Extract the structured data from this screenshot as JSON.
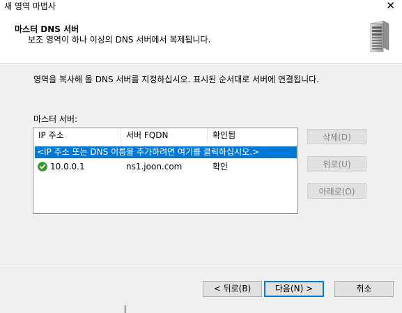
{
  "window": {
    "title": "새 영역 마법사",
    "close_glyph": "✕"
  },
  "header": {
    "title": "마스터 DNS 서버",
    "subtitle": "보조 영역이 하나 이상의 DNS 서버에서 복제됩니다."
  },
  "body": {
    "description": "영역을 복사해 올 DNS 서버를 지정하십시오. 표시된 순서대로 서버에 연결됩니다.",
    "list_label": "마스터 서버:",
    "columns": [
      "IP 주소",
      "서버 FQDN",
      "확인됨"
    ],
    "add_row": "<IP 주소 또는 DNS 이름을 추가하려면 여기를 클릭하십시오.>",
    "rows": [
      {
        "ip": "10.0.0.1",
        "fqdn": "ns1.joon.com",
        "status": "확인"
      }
    ],
    "buttons": {
      "delete": "삭제(D)",
      "up": "위로(U)",
      "down": "아래로(O)"
    }
  },
  "footer": {
    "back": "< 뒤로(B)",
    "next": "다음(N) >",
    "cancel": "취소"
  },
  "colors": {
    "selection": "#0078d7",
    "ok_green": "#3a9b2c"
  }
}
